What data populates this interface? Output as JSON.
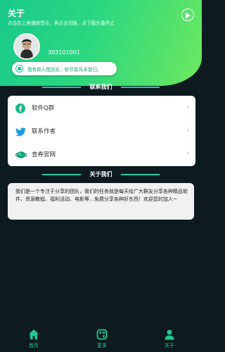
{
  "header": {
    "title": "关于",
    "subtitle": "点击右上角播放音乐，再点击切换，点下面头像停止",
    "play_icon": "play-circle-icon"
  },
  "profile": {
    "user_id": "303101001",
    "avatar": "user-avatar"
  },
  "motto": {
    "text": "我有故人抱剑去，斩尽春风未曾归。"
  },
  "contact": {
    "title": "联系我们",
    "items": [
      {
        "label": "软件Q群",
        "icon": "facebook-icon"
      },
      {
        "label": "联系作者",
        "icon": "twitter-icon"
      },
      {
        "label": "查券官网",
        "icon": "web-icon"
      }
    ]
  },
  "about": {
    "title": "关于我们",
    "text": "我们是一个专注于分享的团队，我们的任务就是每天给广大群友分享各种精品软件、资源教程、福利活动、电影等…免费分享各种好东西！欢迎您的加入~"
  },
  "nav": {
    "items": [
      {
        "label": "首页",
        "icon": "home-icon"
      },
      {
        "label": "更多",
        "icon": "more-icon"
      },
      {
        "label": "关于",
        "icon": "profile-icon"
      }
    ]
  },
  "colors": {
    "accent": "#1cc38b",
    "background": "#0d1b21",
    "line": "#22c9a1"
  }
}
